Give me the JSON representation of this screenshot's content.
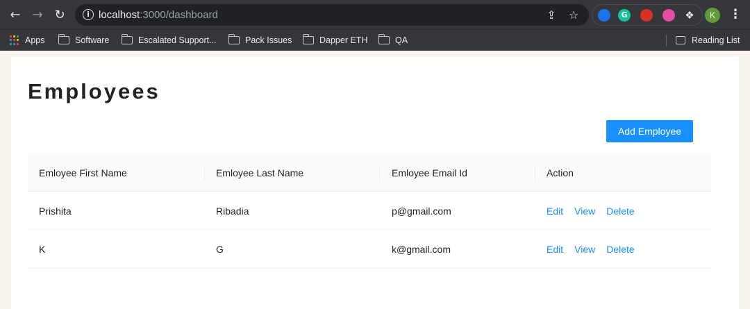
{
  "browser": {
    "url_host": "localhost",
    "url_path": ":3000/dashboard",
    "profile_initial": "K",
    "extensions": [
      {
        "icon": "extension-blue-icon",
        "color": "#1a73e8",
        "label": ""
      },
      {
        "icon": "grammarly-icon",
        "color": "#15c39a",
        "label": "G"
      },
      {
        "icon": "hand-stop-icon",
        "color": "#d93025",
        "label": ""
      },
      {
        "icon": "pink-extension-icon",
        "color": "#e54da3",
        "label": ""
      }
    ]
  },
  "bookmarks": {
    "apps_label": "Apps",
    "folders": [
      "Software",
      "Escalated Support...",
      "Pack Issues",
      "Dapper ETH",
      "QA"
    ],
    "reading_list_label": "Reading List"
  },
  "page": {
    "title": "Employees",
    "add_button_label": "Add Employee",
    "accent_color": "#1890ff"
  },
  "table": {
    "columns": [
      "Emloyee First Name",
      "Emloyee Last Name",
      "Emloyee Email Id",
      "Action"
    ],
    "rows": [
      {
        "first_name": "Prishita",
        "last_name": "Ribadia",
        "email": "p@gmail.com"
      },
      {
        "first_name": "K",
        "last_name": "G",
        "email": "k@gmail.com"
      }
    ],
    "actions": [
      "Edit",
      "View",
      "Delete"
    ]
  }
}
